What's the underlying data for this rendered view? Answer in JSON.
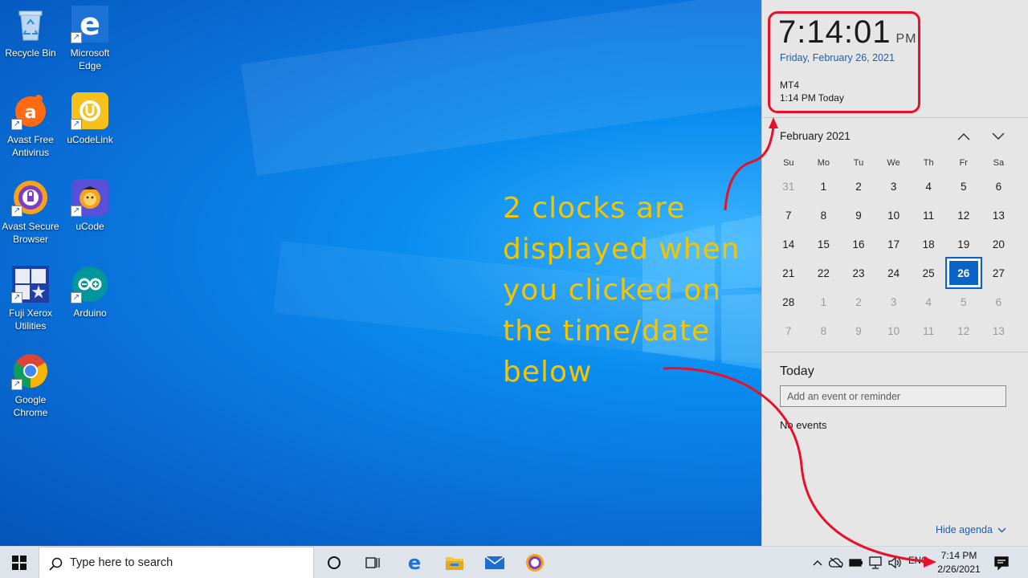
{
  "desktop": {
    "icons": [
      {
        "label": "Recycle Bin"
      },
      {
        "label": "Microsoft Edge"
      },
      {
        "label": "Avast Free Antivirus"
      },
      {
        "label": "uCodeLink"
      },
      {
        "label": "Avast Secure Browser"
      },
      {
        "label": "uCode"
      },
      {
        "label": "Fuji Xerox Utilities"
      },
      {
        "label": "Arduino"
      },
      {
        "label": "Google Chrome"
      }
    ]
  },
  "annotation": {
    "lines": [
      "2 clocks are",
      "displayed when",
      "you clicked on",
      "the time/date",
      "below"
    ],
    "color": "#f5c400",
    "arrow_color": "#e8102a"
  },
  "clock": {
    "time": "7:14:01",
    "ampm": "PM",
    "date": "Friday, February 26, 2021",
    "extra_clock_name": "MT4",
    "extra_clock_time": "1:14 PM Today"
  },
  "calendar": {
    "month_title": "February 2021",
    "days_of_week": [
      "Su",
      "Mo",
      "Tu",
      "We",
      "Th",
      "Fr",
      "Sa"
    ],
    "weeks": [
      [
        "31",
        "1",
        "2",
        "3",
        "4",
        "5",
        "6"
      ],
      [
        "7",
        "8",
        "9",
        "10",
        "11",
        "12",
        "13"
      ],
      [
        "14",
        "15",
        "16",
        "17",
        "18",
        "19",
        "20"
      ],
      [
        "21",
        "22",
        "23",
        "24",
        "25",
        "26",
        "27"
      ],
      [
        "28",
        "1",
        "2",
        "3",
        "4",
        "5",
        "6"
      ],
      [
        "7",
        "8",
        "9",
        "10",
        "11",
        "12",
        "13"
      ]
    ],
    "today": "26",
    "accent": "#0b63c5"
  },
  "agenda": {
    "title": "Today",
    "input_placeholder": "Add an event or reminder",
    "no_events": "No events",
    "hide_label": "Hide agenda"
  },
  "taskbar": {
    "search_placeholder": "Type here to search",
    "language": "ENG",
    "time": "7:14 PM",
    "date": "2/26/2021"
  }
}
